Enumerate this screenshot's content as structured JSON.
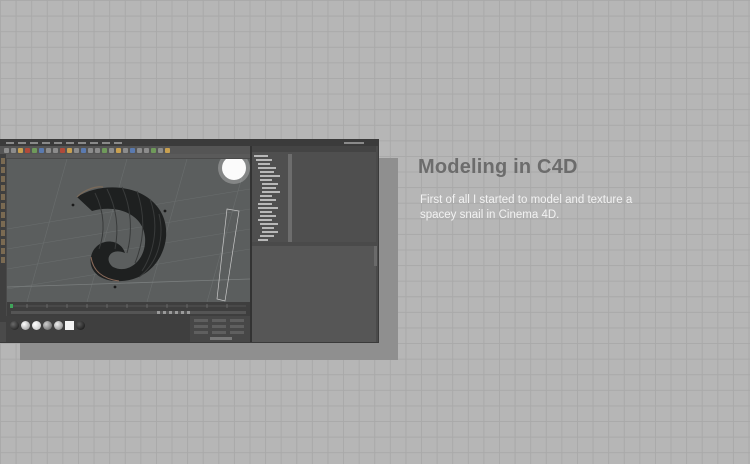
{
  "heading": "Modeling in C4D",
  "description": "First of all I started to model and texture a spacey snail in Cinema 4D.",
  "screenshot": {
    "app": "Cinema 4D",
    "object_manager_rows": 22,
    "materials": [
      "dark",
      "light",
      "white",
      "grey",
      "glow",
      "white-square",
      "dark-2"
    ],
    "colors": {
      "app_background": "#4a4a4a",
      "viewport": "#5b5e5e",
      "page_background": "#b6b6b6",
      "heading": "#6c6c6c",
      "description": "#f2f2f2"
    }
  }
}
